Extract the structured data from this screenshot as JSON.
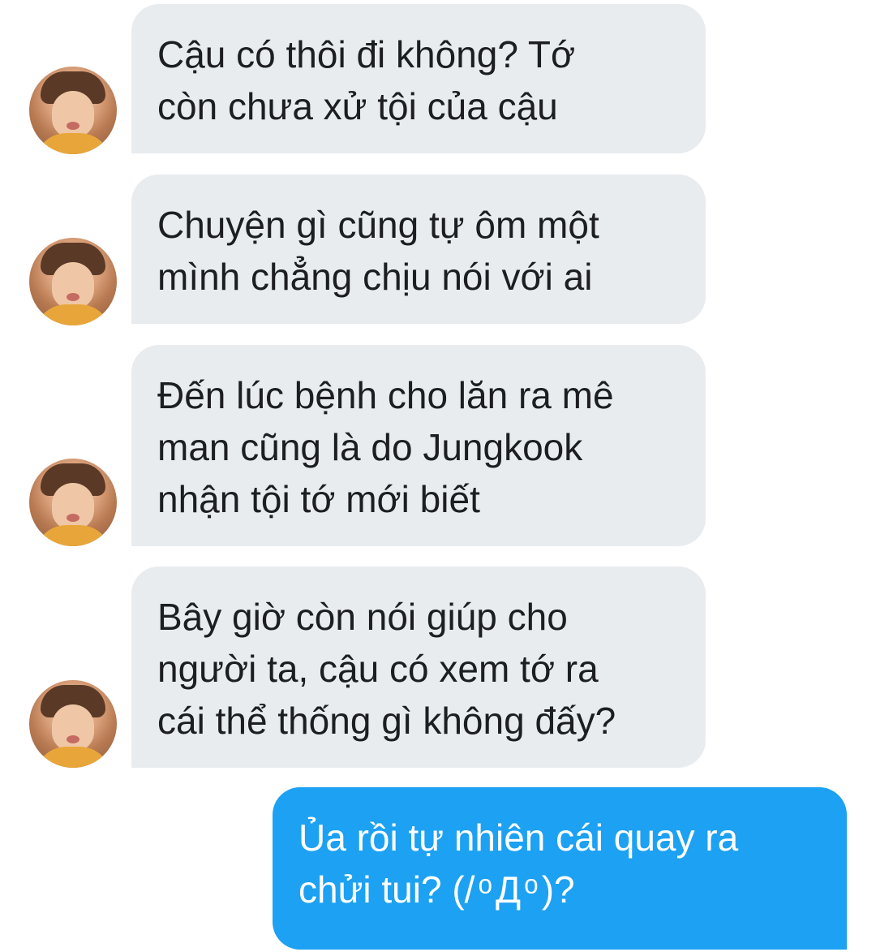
{
  "conversation": {
    "messages": [
      {
        "from": "other",
        "text": "Cậu có thôi đi không? Tớ\ncòn chưa xử tội của cậu"
      },
      {
        "from": "other",
        "text": "Chuyện gì cũng tự ôm một\nmình chẳng chịu nói với ai"
      },
      {
        "from": "other",
        "text": "Đến lúc bệnh cho lăn ra mê\nman cũng là do Jungkook\nnhận tội tớ mới biết"
      },
      {
        "from": "other",
        "text": "Bây giờ còn nói giúp cho\nngười ta, cậu có xem tớ ra\ncái thể thống gì không đấy?"
      },
      {
        "from": "me",
        "text": "Ủa rồi tự nhiên cái quay ra\nchửi tui? (/ ͦ Д ͦ )?"
      }
    ]
  },
  "colors": {
    "received_bubble": "#e9ecef",
    "sent_bubble": "#1da1f2",
    "received_text": "#1c1e21",
    "sent_text": "#ffffff"
  },
  "icons": {
    "avatar": "profile-photo"
  }
}
